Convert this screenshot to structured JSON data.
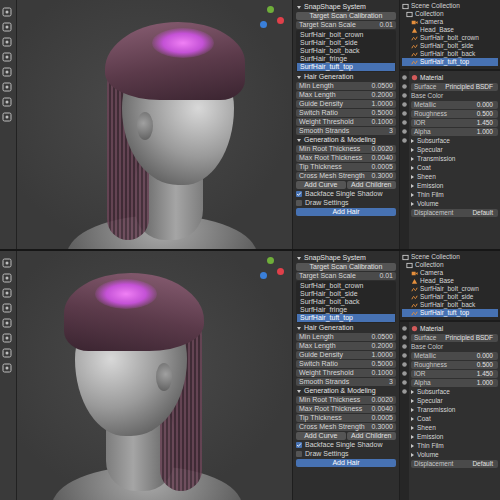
{
  "panes": [
    {
      "kind": "three-quarter",
      "n_panel": {
        "title": "SnapShape System",
        "calibrate": "Target Scan Calibration",
        "scale": {
          "label": "Target Scan Scale",
          "value": "0.01"
        },
        "layers": [
          {
            "label": "SurfHair_bolt_crown",
            "selected": false
          },
          {
            "label": "SurfHair_bolt_side",
            "selected": false
          },
          {
            "label": "SurfHair_bolt_back",
            "selected": false
          },
          {
            "label": "SurfHair_fringe",
            "selected": false
          },
          {
            "label": "SurfHair_tuft_top",
            "selected": true
          }
        ],
        "sections": [
          {
            "title": "Hair Generation",
            "rows": [
              {
                "label": "Min Length",
                "value": "0.0500"
              },
              {
                "label": "Max Length",
                "value": "0.2000"
              },
              {
                "label": "Guide Density",
                "value": "1.0000"
              },
              {
                "label": "Switch Ratio",
                "value": "0.5000"
              },
              {
                "label": "Weight Threshold",
                "value": "0.1000"
              },
              {
                "label": "Smooth Strands",
                "value": "3"
              }
            ]
          },
          {
            "title": "Generation & Modeling",
            "rows": [
              {
                "label": "Min Root Thickness",
                "value": "0.0020"
              },
              {
                "label": "Max Root Thickness",
                "value": "0.0040"
              },
              {
                "label": "Tip Thickness",
                "value": "0.0005"
              },
              {
                "label": "Cross Mesh Strength",
                "value": "0.3000"
              }
            ]
          }
        ],
        "buttons": [
          "Add Curve",
          "Add Children"
        ],
        "toggles": [
          {
            "label": "Backface Single Shadow",
            "checked": true
          },
          {
            "label": "Draw Settings",
            "checked": false
          }
        ],
        "action": "Add Hair"
      },
      "outliner": {
        "items": [
          {
            "label": "Scene Collection",
            "kind": "scene",
            "selected": false
          },
          {
            "label": "Collection",
            "kind": "collection",
            "selected": false
          },
          {
            "label": "Camera",
            "kind": "camera",
            "selected": false
          },
          {
            "label": "Head_Base",
            "kind": "mesh",
            "selected": false
          },
          {
            "label": "SurfHair_bolt_crown",
            "kind": "curves",
            "selected": false
          },
          {
            "label": "SurfHair_bolt_side",
            "kind": "curves",
            "selected": false
          },
          {
            "label": "SurfHair_bolt_back",
            "kind": "curves",
            "selected": false
          },
          {
            "label": "SurfHair_tuft_top",
            "kind": "curves",
            "selected": true
          }
        ]
      },
      "properties": {
        "title": "Material",
        "rows": [
          {
            "label": "Surface",
            "kind": "field",
            "value": "Principled BSDF"
          },
          {
            "label": "Base Color",
            "kind": "swatch",
            "color": "#e8e8e8"
          },
          {
            "label": "Metallic",
            "kind": "field",
            "value": "0.000"
          },
          {
            "label": "Roughness",
            "kind": "field",
            "value": "0.500"
          },
          {
            "label": "IOR",
            "kind": "field",
            "value": "1.450"
          },
          {
            "label": "Alpha",
            "kind": "field",
            "value": "1.000"
          },
          {
            "label": "Subsurface",
            "kind": "section",
            "expanded": false
          },
          {
            "label": "Specular",
            "kind": "section",
            "expanded": false
          },
          {
            "label": "Transmission",
            "kind": "section",
            "expanded": false
          },
          {
            "label": "Coat",
            "kind": "section",
            "expanded": false
          },
          {
            "label": "Sheen",
            "kind": "section",
            "expanded": false
          },
          {
            "label": "Emission",
            "kind": "section",
            "expanded": false
          },
          {
            "label": "Thin Film",
            "kind": "section",
            "expanded": false
          },
          {
            "label": "Volume",
            "kind": "section",
            "expanded": false
          },
          {
            "label": "Displacement",
            "kind": "field",
            "value": "Default"
          }
        ]
      }
    },
    {
      "kind": "profile",
      "n_panel": {
        "title": "SnapShape System",
        "calibrate": "Target Scan Calibration",
        "scale": {
          "label": "Target Scan Scale",
          "value": "0.01"
        },
        "layers": [
          {
            "label": "SurfHair_bolt_crown",
            "selected": false
          },
          {
            "label": "SurfHair_bolt_side",
            "selected": false
          },
          {
            "label": "SurfHair_bolt_back",
            "selected": false
          },
          {
            "label": "SurfHair_fringe",
            "selected": false
          },
          {
            "label": "SurfHair_tuft_top",
            "selected": true
          }
        ],
        "sections": [
          {
            "title": "Hair Generation",
            "rows": [
              {
                "label": "Min Length",
                "value": "0.0500"
              },
              {
                "label": "Max Length",
                "value": "0.2000"
              },
              {
                "label": "Guide Density",
                "value": "1.0000"
              },
              {
                "label": "Switch Ratio",
                "value": "0.5000"
              },
              {
                "label": "Weight Threshold",
                "value": "0.1000"
              },
              {
                "label": "Smooth Strands",
                "value": "3"
              }
            ]
          },
          {
            "title": "Generation & Modeling",
            "rows": [
              {
                "label": "Min Root Thickness",
                "value": "0.0020"
              },
              {
                "label": "Max Root Thickness",
                "value": "0.0040"
              },
              {
                "label": "Tip Thickness",
                "value": "0.0005"
              },
              {
                "label": "Cross Mesh Strength",
                "value": "0.3000"
              }
            ]
          }
        ],
        "buttons": [
          "Add Curve",
          "Add Children"
        ],
        "toggles": [
          {
            "label": "Backface Single Shadow",
            "checked": true
          },
          {
            "label": "Draw Settings",
            "checked": false
          }
        ],
        "action": "Add Hair"
      },
      "outliner": {
        "items": [
          {
            "label": "Scene Collection",
            "kind": "scene",
            "selected": false
          },
          {
            "label": "Collection",
            "kind": "collection",
            "selected": false
          },
          {
            "label": "Camera",
            "kind": "camera",
            "selected": false
          },
          {
            "label": "Head_Base",
            "kind": "mesh",
            "selected": false
          },
          {
            "label": "SurfHair_bolt_crown",
            "kind": "curves",
            "selected": false
          },
          {
            "label": "SurfHair_bolt_side",
            "kind": "curves",
            "selected": false
          },
          {
            "label": "SurfHair_bolt_back",
            "kind": "curves",
            "selected": false
          },
          {
            "label": "SurfHair_tuft_top",
            "kind": "curves",
            "selected": true
          }
        ]
      },
      "properties": {
        "title": "Material",
        "rows": [
          {
            "label": "Surface",
            "kind": "field",
            "value": "Principled BSDF"
          },
          {
            "label": "Base Color",
            "kind": "swatch",
            "color": "#e8e8e8"
          },
          {
            "label": "Metallic",
            "kind": "field",
            "value": "0.000"
          },
          {
            "label": "Roughness",
            "kind": "field",
            "value": "0.500"
          },
          {
            "label": "IOR",
            "kind": "field",
            "value": "1.450"
          },
          {
            "label": "Alpha",
            "kind": "field",
            "value": "1.000"
          },
          {
            "label": "Subsurface",
            "kind": "section",
            "expanded": false
          },
          {
            "label": "Specular",
            "kind": "section",
            "expanded": false
          },
          {
            "label": "Transmission",
            "kind": "section",
            "expanded": false
          },
          {
            "label": "Coat",
            "kind": "section",
            "expanded": false
          },
          {
            "label": "Sheen",
            "kind": "section",
            "expanded": false
          },
          {
            "label": "Emission",
            "kind": "section",
            "expanded": false
          },
          {
            "label": "Thin Film",
            "kind": "section",
            "expanded": false
          },
          {
            "label": "Volume",
            "kind": "section",
            "expanded": false
          },
          {
            "label": "Displacement",
            "kind": "field",
            "value": "Default"
          }
        ]
      }
    }
  ]
}
